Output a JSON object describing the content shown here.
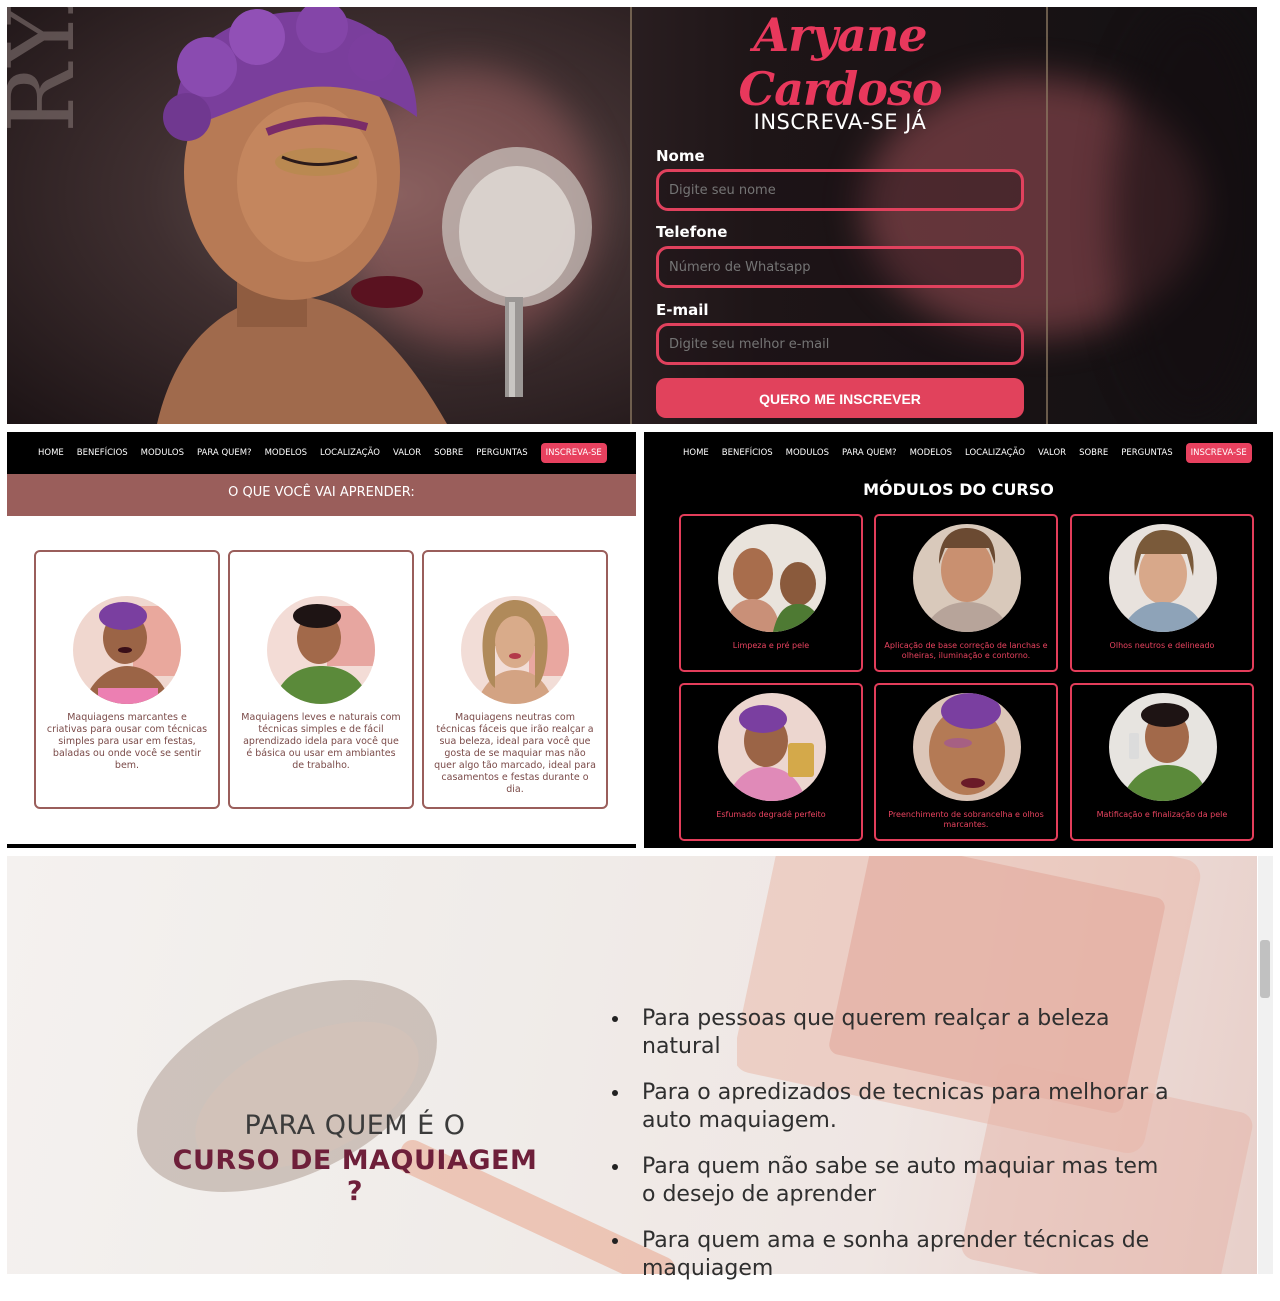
{
  "hero": {
    "side_letters": "RYAN",
    "brand": "Aryane Cardoso",
    "form_title": "INSCREVA-SE JÁ",
    "fields": [
      {
        "label": "Nome",
        "placeholder": "Digite seu nome"
      },
      {
        "label": "Telefone",
        "placeholder": "Número de Whatsapp"
      },
      {
        "label": "E-mail",
        "placeholder": "Digite seu melhor e-mail"
      }
    ],
    "submit_label": "QUERO ME INSCREVER"
  },
  "nav": {
    "items": [
      "HOME",
      "BENEFÍCIOS",
      "MODULOS",
      "PARA QUEM?",
      "MODELOS",
      "LOCALIZAÇÃO",
      "VALOR",
      "SOBRE",
      "PERGUNTAS"
    ],
    "cta": "INSCREVA-SE"
  },
  "learn": {
    "title": "O QUE VOCÊ VAI APRENDER:",
    "cards": [
      {
        "text": "Maquiagens marcantes e criativas para ousar com técnicas simples para usar em festas, baladas ou onde você se sentir bem."
      },
      {
        "text": "Maquiagens leves e naturais com técnicas simples e de fácil aprendizado idela para você que é básica ou usar em ambiantes de trabalho."
      },
      {
        "text": "Maquiagens neutras com técnicas fáceis que irão realçar a sua beleza, ideal para você que gosta de se maquiar mas não quer algo tão marcado, ideal para casamentos e festas durante o dia."
      }
    ]
  },
  "modules": {
    "title": "MÓDULOS DO CURSO",
    "cards": [
      {
        "text": "Limpeza e pré pele"
      },
      {
        "text": "Aplicação de base correção de lanchas e olheiras, iluminação e contorno."
      },
      {
        "text": "Olhos neutros e delineado"
      },
      {
        "text": "Esfumado degradê perfeito"
      },
      {
        "text": "Preenchimento de sobrancelha e olhos marcantes."
      },
      {
        "text": "Matificação e finalização da pele"
      }
    ]
  },
  "who": {
    "title_line1": "PARA QUEM É O",
    "title_line2": "CURSO DE MAQUIAGEM ?",
    "items": [
      "Para pessoas que querem realçar a beleza natural",
      "Para o apredizados de tecnicas para melhorar a auto maquiagem.",
      "Para quem não sabe se auto maquiar mas tem o desejo de aprender",
      "Para quem ama e sonha aprender técnicas de maquiagem"
    ]
  },
  "colors": {
    "accent": "#e1425c",
    "learn_bar": "#9a5e5b",
    "dark": "#000000",
    "who_title": "#6e1f3a"
  }
}
